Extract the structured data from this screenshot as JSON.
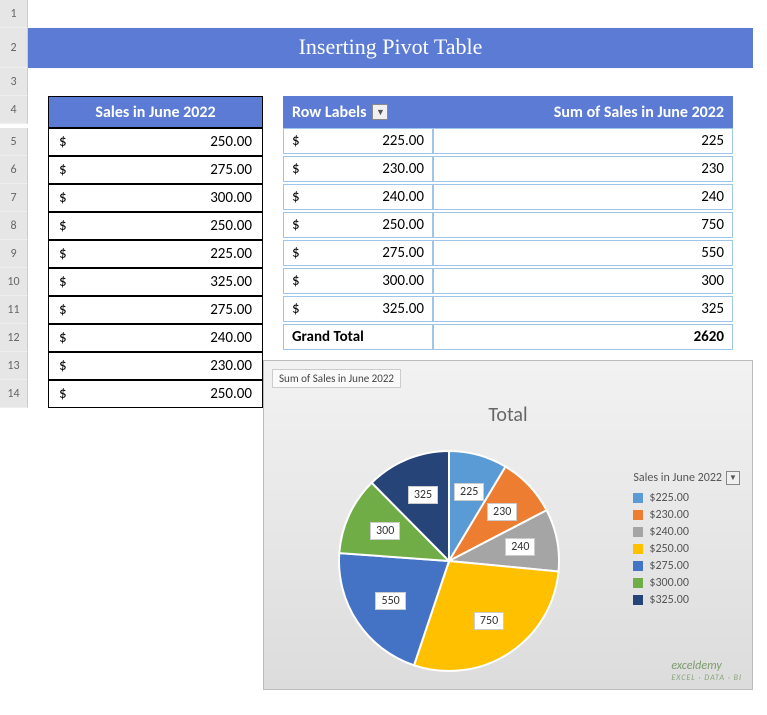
{
  "title_banner": "Inserting Pivot Table",
  "row_headers": [
    "1",
    "2",
    "3",
    "4",
    "5",
    "6",
    "7",
    "8",
    "9",
    "10",
    "11",
    "12",
    "13",
    "14"
  ],
  "left_table": {
    "header": "Sales in June 2022",
    "rows": [
      "250.00",
      "275.00",
      "300.00",
      "250.00",
      "225.00",
      "325.00",
      "275.00",
      "240.00",
      "230.00",
      "250.00"
    ]
  },
  "pivot": {
    "col_row_labels": "Row Labels",
    "col_sum": "Sum of Sales in June 2022",
    "rows": [
      {
        "label": "225.00",
        "value": "225"
      },
      {
        "label": "230.00",
        "value": "230"
      },
      {
        "label": "240.00",
        "value": "240"
      },
      {
        "label": "250.00",
        "value": "750"
      },
      {
        "label": "275.00",
        "value": "550"
      },
      {
        "label": "300.00",
        "value": "300"
      },
      {
        "label": "325.00",
        "value": "325"
      }
    ],
    "grand_label": "Grand Total",
    "grand_value": "2620"
  },
  "chart": {
    "tag": "Sum of Sales in June 2022",
    "title": "Total",
    "legend_title": "Sales in June 2022",
    "legend": [
      {
        "label": "$225.00",
        "color": "#5b9bd5"
      },
      {
        "label": "$230.00",
        "color": "#ed7d31"
      },
      {
        "label": "$240.00",
        "color": "#a5a5a5"
      },
      {
        "label": "$250.00",
        "color": "#ffc000"
      },
      {
        "label": "$275.00",
        "color": "#4472c4"
      },
      {
        "label": "$300.00",
        "color": "#70ad47"
      },
      {
        "label": "$325.00",
        "color": "#264478"
      }
    ],
    "slice_labels": [
      "225",
      "230",
      "240",
      "750",
      "550",
      "300",
      "325"
    ]
  },
  "currency_symbol": "$",
  "watermark": {
    "main": "exceldemy",
    "sub": "EXCEL · DATA · BI"
  },
  "chart_data": {
    "type": "pie",
    "title": "Total",
    "categories": [
      "$225.00",
      "$230.00",
      "$240.00",
      "$250.00",
      "$275.00",
      "$300.00",
      "$325.00"
    ],
    "values": [
      225,
      230,
      240,
      750,
      550,
      300,
      325
    ],
    "colors": [
      "#5b9bd5",
      "#ed7d31",
      "#a5a5a5",
      "#ffc000",
      "#4472c4",
      "#70ad47",
      "#264478"
    ],
    "legend_position": "right",
    "data_labels": true,
    "total": 2620
  }
}
